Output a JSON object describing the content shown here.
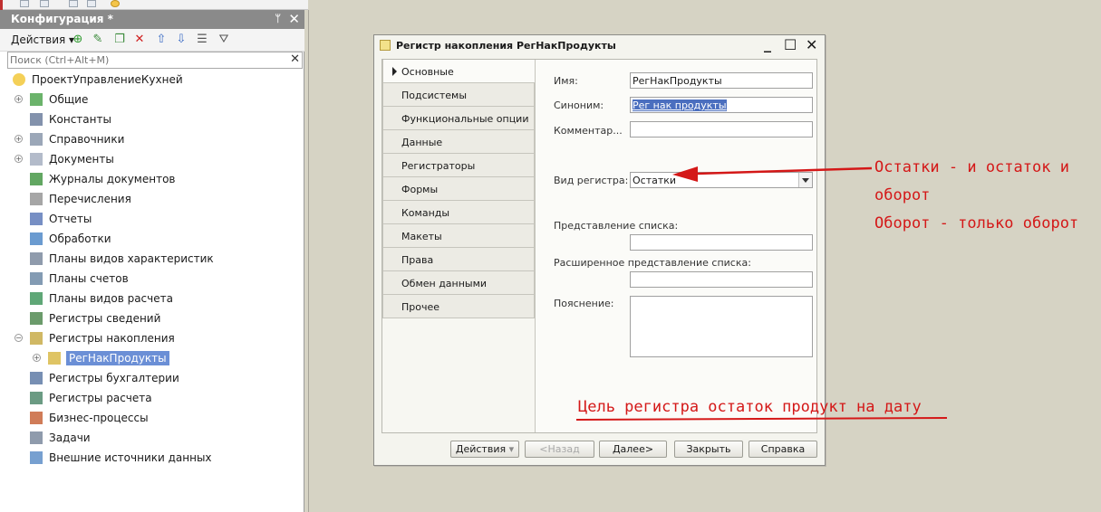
{
  "config_panel": {
    "title": "Конфигурация *",
    "actions_label": "Действия",
    "search_placeholder": "Поиск (Ctrl+Alt+M)",
    "tree": [
      {
        "label": "ПроектУправлениеКухней",
        "icon": "config-root-icon"
      },
      {
        "label": "Общие",
        "icon": "common-icon"
      },
      {
        "label": "Константы",
        "icon": "constants-icon"
      },
      {
        "label": "Справочники",
        "icon": "catalogs-icon"
      },
      {
        "label": "Документы",
        "icon": "documents-icon"
      },
      {
        "label": "Журналы документов",
        "icon": "journals-icon"
      },
      {
        "label": "Перечисления",
        "icon": "enums-icon"
      },
      {
        "label": "Отчеты",
        "icon": "reports-icon"
      },
      {
        "label": "Обработки",
        "icon": "processing-icon"
      },
      {
        "label": "Планы видов характеристик",
        "icon": "char-plans-icon"
      },
      {
        "label": "Планы счетов",
        "icon": "accounts-plans-icon"
      },
      {
        "label": "Планы видов расчета",
        "icon": "calc-plans-icon"
      },
      {
        "label": "Регистры сведений",
        "icon": "info-registers-icon"
      },
      {
        "label": "Регистры накопления",
        "icon": "accum-registers-icon"
      },
      {
        "label": "РегНакПродукты",
        "icon": "register-icon"
      },
      {
        "label": "Регистры бухгалтерии",
        "icon": "acc-registers-icon"
      },
      {
        "label": "Регистры расчета",
        "icon": "calc-registers-icon"
      },
      {
        "label": "Бизнес-процессы",
        "icon": "business-process-icon"
      },
      {
        "label": "Задачи",
        "icon": "tasks-icon"
      },
      {
        "label": "Внешние источники данных",
        "icon": "external-sources-icon"
      }
    ]
  },
  "dialog": {
    "title": "Регистр накопления РегНакПродукты",
    "tabs": [
      "Основные",
      "Подсистемы",
      "Функциональные опции",
      "Данные",
      "Регистраторы",
      "Формы",
      "Команды",
      "Макеты",
      "Права",
      "Обмен данными",
      "Прочее"
    ],
    "labels": {
      "name": "Имя:",
      "synonym": "Синоним:",
      "comment": "Комментар...",
      "register_type": "Вид регистра:",
      "list_presentation": "Представление списка:",
      "ext_list_presentation": "Расширенное представление списка:",
      "explanation": "Пояснение:"
    },
    "values": {
      "name": "РегНакПродукты",
      "synonym": "Рег нак продукты",
      "comment": "",
      "register_type": "Остатки",
      "list_presentation": "",
      "ext_list_presentation": "",
      "explanation": ""
    },
    "buttons": {
      "actions": "Действия",
      "back": "<Назад",
      "next": "Далее>",
      "close": "Закрыть",
      "help": "Справка"
    }
  },
  "annotations": {
    "line1": "Остатки - и остаток и",
    "line2": "оборот",
    "line3": "Оборот - только оборот",
    "goal": "Цель регистра остаток продукт на дату",
    "color": "#d41818"
  }
}
